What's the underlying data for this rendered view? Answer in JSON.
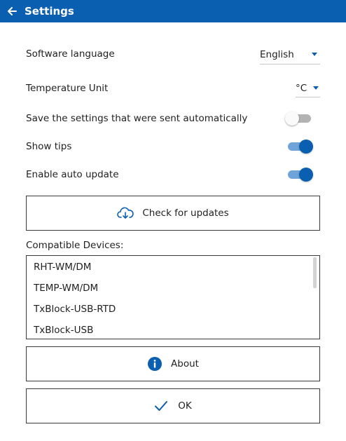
{
  "colors": {
    "accent": "#0a5fb0",
    "accent_light": "#6fa4d8",
    "toggle_off": "#b3b3b3"
  },
  "header": {
    "title": "Settings",
    "back_icon": "arrow-left-icon"
  },
  "settings": {
    "language_label": "Software language",
    "language_value": "English",
    "unit_label": "Temperature Unit",
    "unit_value": "°C",
    "save_auto_label": "Save the settings that were sent automatically",
    "save_auto_on": false,
    "show_tips_label": "Show tips",
    "show_tips_on": true,
    "auto_update_label": "Enable auto update",
    "auto_update_on": true
  },
  "check_updates": {
    "label": "Check for updates",
    "icon": "cloud-download-icon"
  },
  "devices": {
    "label": "Compatible Devices:",
    "items": [
      "RHT-WM/DM",
      "TEMP-WM/DM",
      "TxBlock-USB-RTD",
      "TxBlock-USB"
    ]
  },
  "about": {
    "label": "About",
    "icon": "info-icon"
  },
  "ok": {
    "label": "OK",
    "icon": "checkmark-icon"
  }
}
